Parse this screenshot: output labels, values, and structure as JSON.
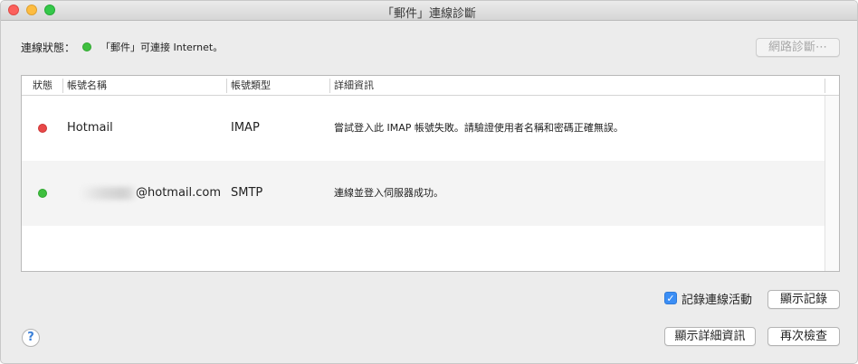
{
  "window": {
    "title": "「郵件」連線診斷"
  },
  "status": {
    "label": "連線狀態：",
    "text": "「郵件」可連接 Internet。",
    "indicator_color": "#3fbf3f"
  },
  "toolbar": {
    "network_diagnostics_label": "網路診斷⋯"
  },
  "table": {
    "columns": [
      "狀態",
      "帳號名稱",
      "帳號類型",
      "詳細資訊"
    ],
    "rows": [
      {
        "status_color": "#e84848",
        "account": "Hotmail",
        "type": "IMAP",
        "detail": "嘗試登入此 IMAP 帳號失敗。請驗證使用者名稱和密碼正確無誤。"
      },
      {
        "status_color": "#3fbf3f",
        "account": "@hotmail.com",
        "type": "SMTP",
        "detail": "連線並登入伺服器成功。"
      }
    ]
  },
  "log": {
    "checkbox_label": "記錄連線活動",
    "checked": true,
    "show_log_label": "顯示記錄"
  },
  "footer": {
    "show_details_label": "顯示詳細資訊",
    "check_again_label": "再次檢查",
    "help_label": "?"
  }
}
